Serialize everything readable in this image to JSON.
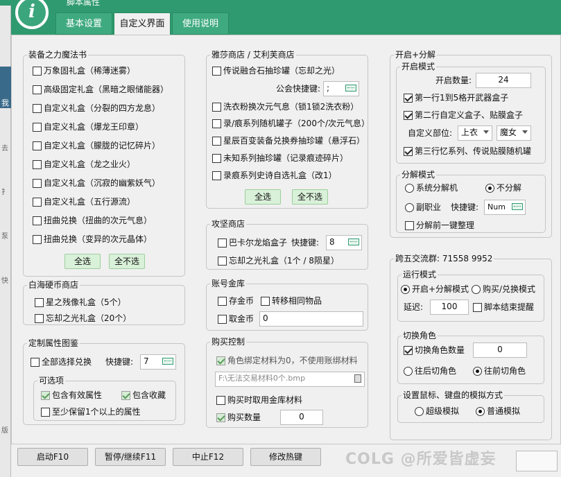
{
  "app": {
    "title": "脚本属性",
    "logo_letter": "i"
  },
  "tabs": [
    "基本设置",
    "自定义界面",
    "使用说明"
  ],
  "sidebar_fragments": [
    "我",
    "去",
    "扌",
    "泵",
    "快",
    "版"
  ],
  "magic_book": {
    "title": "装备之力魔法书",
    "items": [
      {
        "label": "万象固礼盒（稀薄迷雾）",
        "checked": false
      },
      {
        "label": "高级固定礼盒（黑暗之眼储能器）",
        "checked": false
      },
      {
        "label": "自定义礼盒（分裂的四方龙息）",
        "checked": false
      },
      {
        "label": "自定义礼盒（爆龙王印章）",
        "checked": false
      },
      {
        "label": "自定义礼盒（朦胧的记忆碎片）",
        "checked": false
      },
      {
        "label": "自定义礼盒（龙之业火）",
        "checked": false
      },
      {
        "label": "自定义礼盒（沉寂的幽紫妖气）",
        "checked": false
      },
      {
        "label": "自定义礼盒（五行源流）",
        "checked": false
      },
      {
        "label": "扭曲兑换（扭曲的次元气息）",
        "checked": false
      },
      {
        "label": "扭曲兑换（变异的次元晶体）",
        "checked": false
      }
    ],
    "select_all": "全选",
    "select_none": "全不选"
  },
  "white_sea": {
    "title": "白海硬币商店",
    "items": [
      {
        "label": "星之残像礼盒（5个）"
      },
      {
        "label": "忘却之光礼盒（20个）"
      }
    ]
  },
  "custom_attr": {
    "title": "定制属性图鉴",
    "select_all_label": "全部选择兑换",
    "hotkey_label": "快捷键:",
    "hotkey_value": "7",
    "options_title": "可选项",
    "include_valid": "包含有效属性",
    "include_collect": "包含收藏",
    "keep_one": "至少保留1个以上的属性"
  },
  "yasha": {
    "title": "雅莎商店 / 艾利芙商店",
    "items": [
      {
        "label": "传说融合石抽珍罐（忘却之光）"
      },
      {
        "label": "洗衣粉换次元气息（锁1锁2洗衣粉）"
      },
      {
        "label": "录/痕系列随机罐子（200个/次元气息）"
      },
      {
        "label": "星辰百变装备兑换券抽珍罐（悬浮石）"
      },
      {
        "label": "未知系列抽珍罐（记录痕迹碎片）"
      },
      {
        "label": "录痕系列史诗自选礼盒（改1）"
      }
    ],
    "guild_hotkey_label": "公会快捷键:",
    "guild_hotkey_value": ";",
    "select_all": "全选",
    "select_none": "全不选"
  },
  "attack_shop": {
    "title": "攻坚商店",
    "items": [
      {
        "label": "巴卡尔龙焰盒子",
        "hotkey_label": "快捷键:",
        "hotkey_value": "8"
      },
      {
        "label": "忘却之光礼盒（1个 / 8陨星）"
      }
    ]
  },
  "account_vault": {
    "title": "账号金库",
    "deposit": "存金币",
    "move_same": "转移相同物品",
    "withdraw": "取金币",
    "withdraw_value": "0"
  },
  "purchase": {
    "title": "购买控制",
    "bind_label": "角色绑定材料为0，不使用账绑材料",
    "file_path": "F:\\无法交易材料0个.bmp",
    "use_vault": "购买时取用金库材料",
    "buy_qty_label": "购买数量",
    "buy_qty_value": "0"
  },
  "open_decompose": {
    "title": "开启+分解",
    "open_mode_title": "开启模式",
    "open_count_label": "开启数量:",
    "open_count_value": "24",
    "row1": "第一行1到5格开武器盒子",
    "row2": "第二行自定义盒子、贴膜盒子",
    "custom_part_label": "自定义部位:",
    "custom_part_value": "上衣",
    "job_value": "魔女",
    "row3": "第三行忆系列、传说贴膜随机罐",
    "decompose_title": "分解模式",
    "sys_decompose": "系统分解机",
    "no_decompose": "不分解",
    "sub_job": "副职业",
    "sub_hotkey_label": "快捷键:",
    "sub_hotkey_value": "Num",
    "pre_tidy": "分解前一键整理"
  },
  "group_info": {
    "label": "跨五交流群: 71558 9952"
  },
  "run_mode": {
    "title": "运行模式",
    "open_mode": "开启+分解模式",
    "buy_mode": "购买/兑换模式",
    "delay_label": "延迟:",
    "delay_value": "100",
    "end_alert": "脚本结束提醒"
  },
  "switch_role": {
    "title": "切换角色",
    "switch_count_label": "切换角色数量",
    "switch_count_value": "0",
    "back": "往后切角色",
    "forward": "往前切角色"
  },
  "simulation": {
    "title": "设置鼠标、键盘的模拟方式",
    "super": "超级模拟",
    "normal": "普通模拟"
  },
  "bottom_buttons": [
    "启动F10",
    "暂停/继续F11",
    "中止F12",
    "修改热键"
  ],
  "watermark": "COLG @所爱皆虚妄"
}
